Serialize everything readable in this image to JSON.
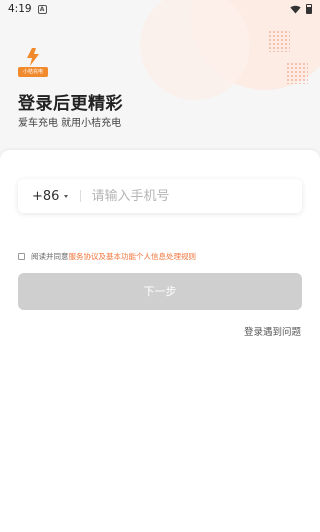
{
  "status_bar": {
    "time": "4:19",
    "notification_glyph": "A"
  },
  "logo": {
    "brand_tag": "小桔充电",
    "accent": "#f08a2d"
  },
  "header": {
    "title": "登录后更精彩",
    "subtitle": "爱车充电 就用小桔充电"
  },
  "login": {
    "country_code": "+86",
    "phone_placeholder": "请输入手机号",
    "agree_prefix": "阅读并同意",
    "agree_link": "服务协议及基本功能个人信息处理规则",
    "next_button": "下一步",
    "help_link": "登录遇到问题"
  },
  "colors": {
    "link": "#f0743a",
    "button_disabled": "#cfcfcf"
  }
}
